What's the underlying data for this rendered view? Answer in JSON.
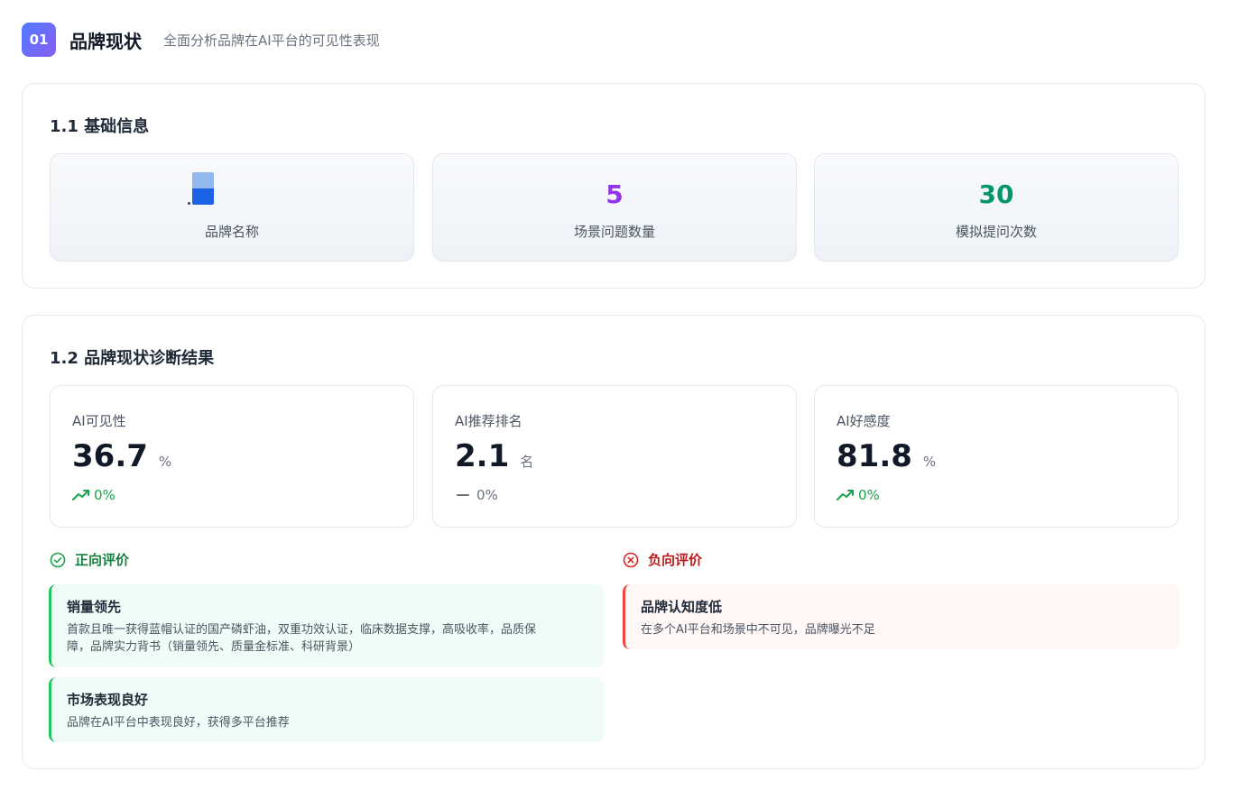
{
  "header": {
    "badge": "01",
    "title": "品牌现状",
    "subtitle": "全面分析品牌在AI平台的可见性表现"
  },
  "basic_info": {
    "title": "1.1 基础信息",
    "cards": [
      {
        "label": "品牌名称",
        "icon": "brand-logo-icon"
      },
      {
        "value": "5",
        "label": "场景问题数量",
        "color": "#9333ea"
      },
      {
        "value": "30",
        "label": "模拟提问次数",
        "color": "#059669"
      }
    ]
  },
  "diagnosis": {
    "title": "1.2 品牌现状诊断结果",
    "metrics": [
      {
        "label": "AI可见性",
        "value": "36.7",
        "unit": "%",
        "change": "0%",
        "trend": "up"
      },
      {
        "label": "AI推荐排名",
        "value": "2.1",
        "unit": "名",
        "change": "0%",
        "trend": "flat"
      },
      {
        "label": "AI好感度",
        "value": "81.8",
        "unit": "%",
        "change": "0%",
        "trend": "up"
      }
    ],
    "positive": {
      "title": "正向评价",
      "items": [
        {
          "title": "销量领先",
          "desc_line1": "首款且唯一获得蓝帽认证的国产磷虾油，双重功效认证，临床数据支撑，高吸收率，品质保",
          "desc_line2": "障，品牌实力背书（销量领先、质量金标准、科研背景）"
        },
        {
          "title": "市场表现良好",
          "desc_line1": "品牌在AI平台中表现良好，获得多平台推荐"
        }
      ]
    },
    "negative": {
      "title": "负向评价",
      "items": [
        {
          "title": "品牌认知度低",
          "desc_line1": "在多个AI平台和场景中不可见，品牌曝光不足"
        }
      ]
    }
  },
  "colors": {
    "positive": "#16a34a",
    "negative": "#dc2626",
    "accent": "#6366f1"
  }
}
